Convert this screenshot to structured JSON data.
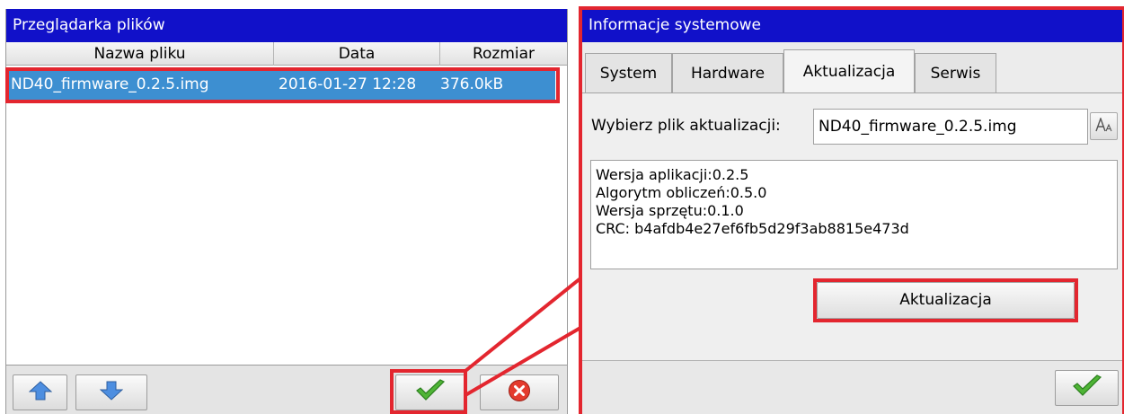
{
  "file_browser": {
    "title": "Przeglądarka plików",
    "columns": [
      "Nazwa pliku",
      "Data",
      "Rozmiar"
    ],
    "rows": [
      {
        "name": "ND40_firmware_0.2.5.img",
        "date": "2016-01-27 12:28",
        "size": "376.0kB"
      }
    ],
    "buttons": [
      "arrow-up-icon",
      "arrow-down-icon",
      "checkmark-icon",
      "cancel-icon"
    ]
  },
  "system_info": {
    "title": "Informacje systemowe",
    "tabs": [
      "System",
      "Hardware",
      "Aktualizacja",
      "Serwis"
    ],
    "active_tab": "Aktualizacja",
    "file_label": "Wybierz plik aktualizacji:",
    "file_value": "ND40_firmware_0.2.5.img",
    "info_lines": [
      "Wersja aplikacji:0.2.5",
      "Algorytm obliczeń:0.5.0",
      "Wersja sprzętu:0.1.0",
      "CRC: b4afdb4e27ef6fb5d29f3ab8815e473d"
    ],
    "update_button": "Aktualizacja"
  },
  "colors": {
    "titlebar": "#1111c9",
    "selection": "#3d8fd1",
    "highlight": "#e3262f"
  }
}
